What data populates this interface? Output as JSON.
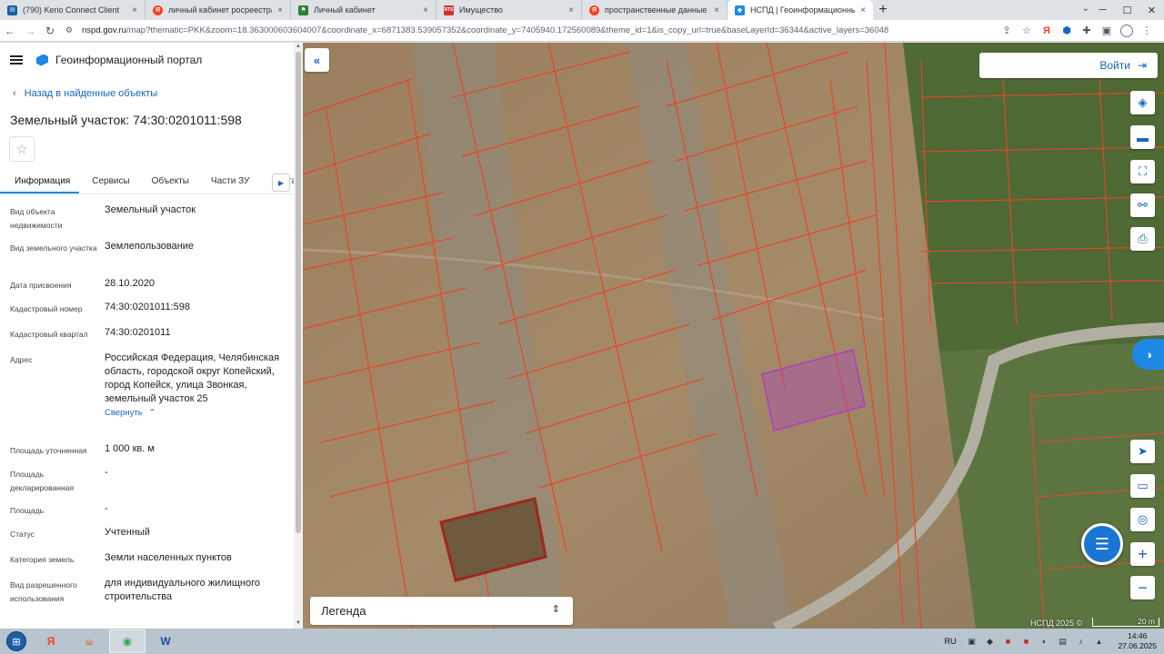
{
  "browser": {
    "tabs": [
      {
        "title": "(790) Kerio Connect Client",
        "favicon": "kerio-icon",
        "color": "#1b5fa8",
        "active": false
      },
      {
        "title": "личный кабинет росреестра —",
        "favicon": "yandex-icon",
        "color": "#fc3f1d",
        "active": false
      },
      {
        "title": "Личный кабинет",
        "favicon": "rosreestr-icon",
        "color": "#2e7d32",
        "active": false
      },
      {
        "title": "Имущество",
        "favicon": "rts-icon",
        "color": "#d32f2f",
        "active": false
      },
      {
        "title": "пространственные данные рос",
        "favicon": "yandex-icon",
        "color": "#fc3f1d",
        "active": false
      },
      {
        "title": "НСПД | Геоинформационный п",
        "favicon": "nspd-icon",
        "color": "#1e88e5",
        "active": true
      }
    ],
    "new_tab": "+",
    "url_host": "nspd.gov.ru",
    "url_rest": "/map?thematic=PKK&zoom=18.363000603604007&coordinate_x=6871383.539057352&coordinate_y=7405940.172560089&theme_id=1&is_copy_url=true&baseLayerId=36344&active_layers=36048"
  },
  "panel": {
    "portal_title": "Геоинформационный портал",
    "back_label": "Назад в найденные объекты",
    "object_title": "Земельный участок: 74:30:0201011:598",
    "tabs": [
      "Информация",
      "Сервисы",
      "Объекты",
      "Части ЗУ",
      "Соста"
    ],
    "collapse_label": "Свернуть",
    "properties": [
      {
        "key": "Вид объекта недвижимости",
        "value": "Земельный участок"
      },
      {
        "key": "Вид земельного участка",
        "value": "Землепользование"
      },
      {
        "key": "Дата присвоения",
        "value": "28.10.2020"
      },
      {
        "key": "Кадастровый номер",
        "value": "74:30:0201011:598"
      },
      {
        "key": "Кадастровый квартал",
        "value": "74:30:0201011"
      },
      {
        "key": "Адрес",
        "value": "Российская Федерация, Челябинская область, городской округ Копейский, город Копейск, улица Звонкая, земельный участок 25"
      },
      {
        "key": "Площадь уточненная",
        "value": "1 000 кв. м"
      },
      {
        "key": "Площадь декларированная",
        "value": "-"
      },
      {
        "key": "Площадь",
        "value": "-"
      },
      {
        "key": "Статус",
        "value": "Учтенный"
      },
      {
        "key": "Категория земель",
        "value": "Земли населенных пунктов"
      },
      {
        "key": "Вид разрешенного использования",
        "value": "для индивидуального жилищного строительства"
      }
    ]
  },
  "map": {
    "login_label": "Войти",
    "legend_label": "Легенда",
    "attribution": "НСПД 2025 ©",
    "scale_label": "20 m",
    "tools": [
      "layers-icon",
      "ruler-icon",
      "select-area-icon",
      "share-icon",
      "print-icon"
    ],
    "tools_lower": [
      "navigation-icon",
      "screen-icon",
      "locate-icon"
    ],
    "colors": {
      "parcel": "#e8462a",
      "selected": "#b03cc8",
      "accent": "#1565c0"
    }
  },
  "taskbar": {
    "lang": "RU",
    "time": "14:46",
    "date": "27.06.2025"
  }
}
